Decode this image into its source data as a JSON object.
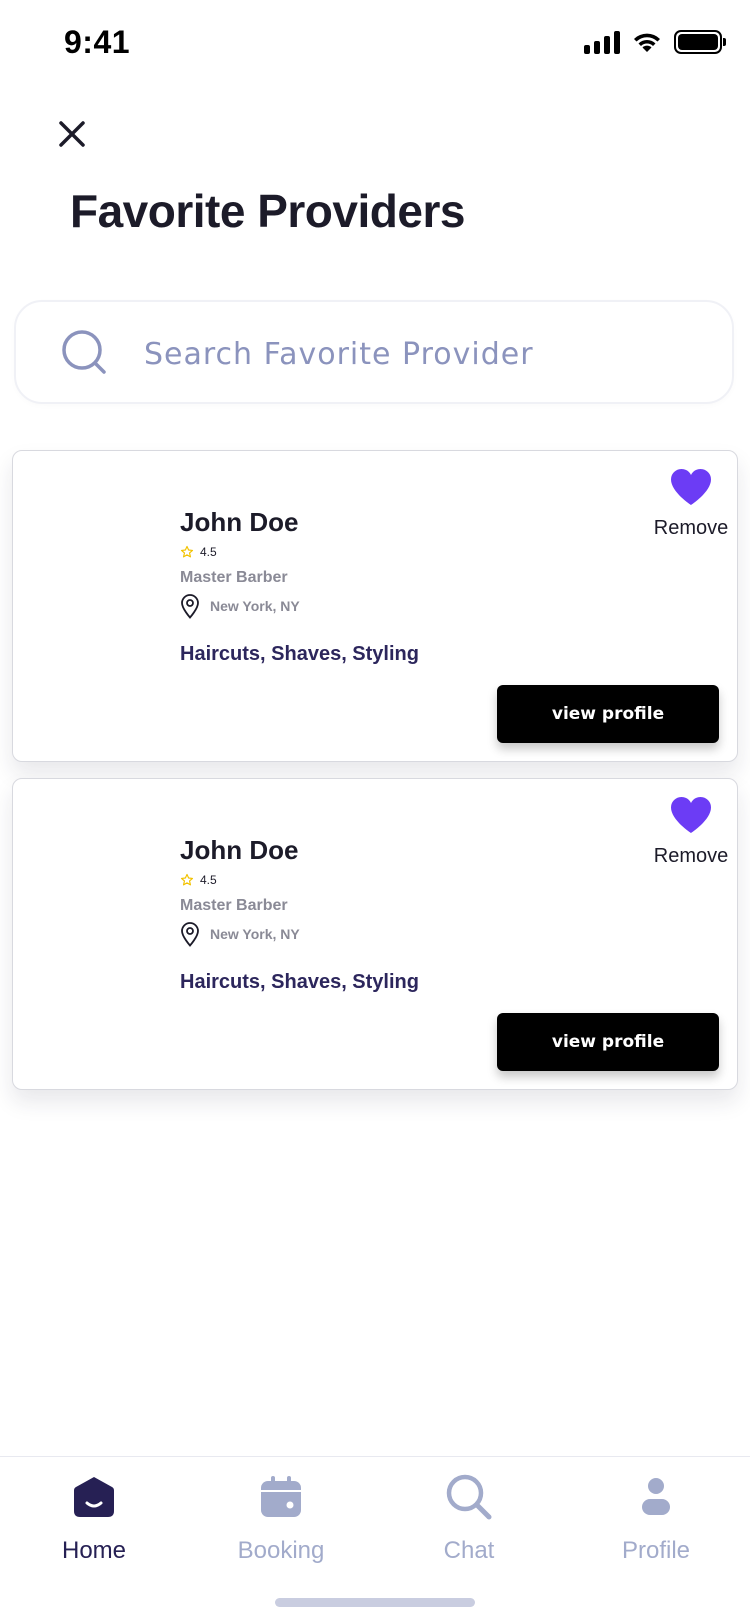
{
  "status_bar": {
    "time": "9:41"
  },
  "header": {
    "title": "Favorite Providers"
  },
  "search": {
    "placeholder": "Search Favorite Provider",
    "value": ""
  },
  "providers": [
    {
      "name": "John Doe",
      "rating": "4.5",
      "role": "Master Barber",
      "location": "New York, NY",
      "services": "Haircuts, Shaves, Styling",
      "remove_label": "Remove",
      "button_label": "view profile"
    },
    {
      "name": "John Doe",
      "rating": "4.5",
      "role": "Master Barber",
      "location": "New York, NY",
      "services": "Haircuts, Shaves, Styling",
      "remove_label": "Remove",
      "button_label": "view profile"
    }
  ],
  "nav": {
    "items": [
      {
        "label": "Home",
        "icon": "home-icon",
        "active": true
      },
      {
        "label": "Booking",
        "icon": "calendar-icon",
        "active": false
      },
      {
        "label": "Chat",
        "icon": "search-icon",
        "active": false
      },
      {
        "label": "Profile",
        "icon": "profile-icon",
        "active": false
      }
    ]
  },
  "colors": {
    "accent": "#6c3cf5",
    "nav_active": "#262054",
    "nav_inactive": "#a2abcb",
    "button_bg": "#000000",
    "star": "#f2c200"
  }
}
